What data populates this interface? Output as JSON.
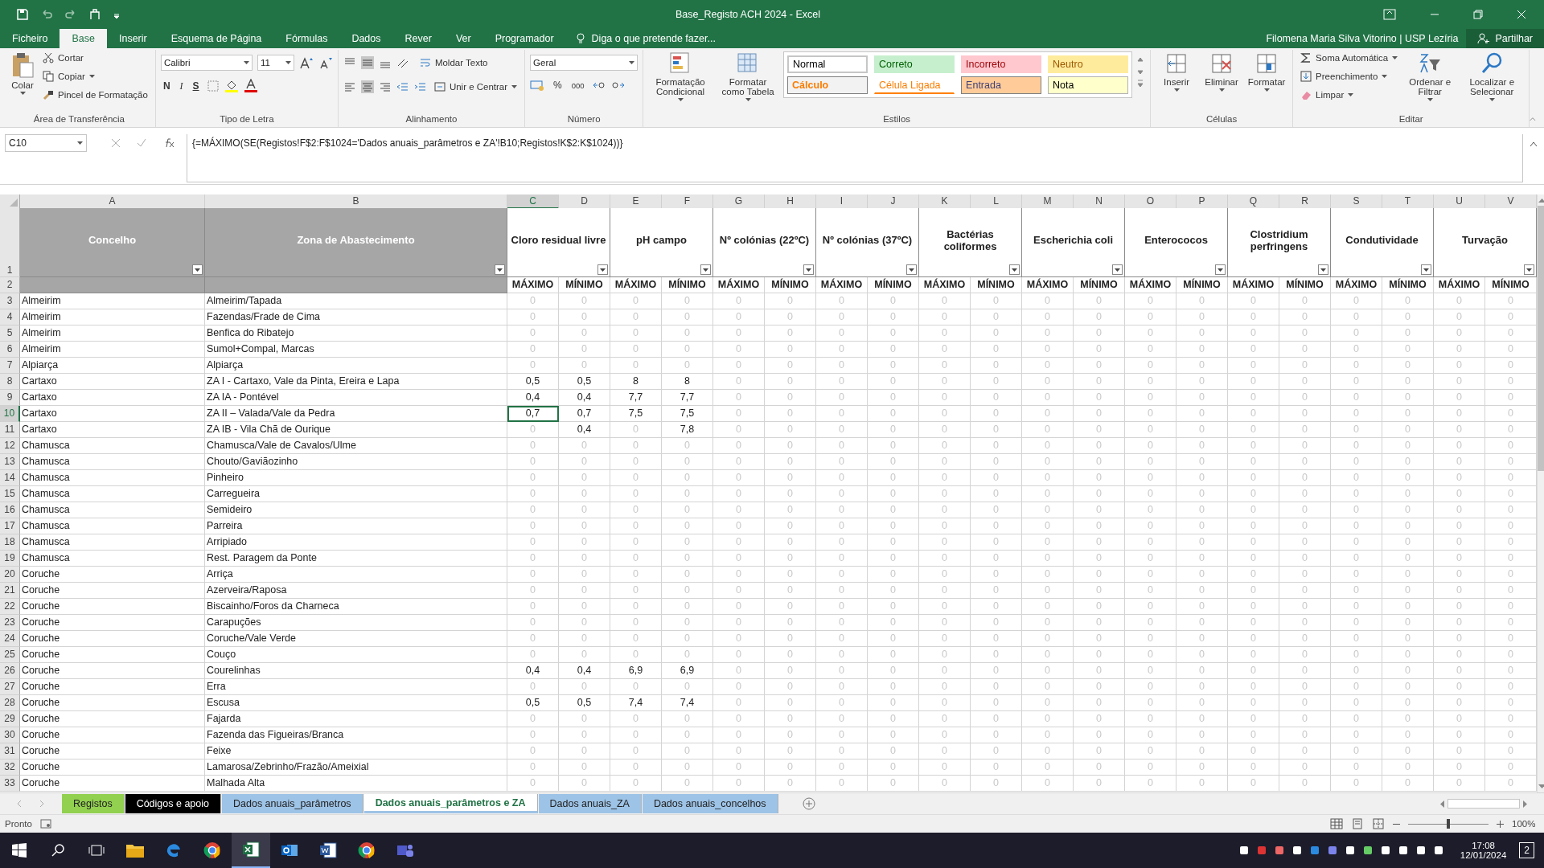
{
  "window": {
    "title": "Base_Registo ACH 2024 - Excel",
    "user": "Filomena Maria Silva Vitorino | USP Lezíria",
    "share": "Partilhar"
  },
  "menu_tabs": [
    {
      "label": "Ficheiro",
      "selected": false
    },
    {
      "label": "Base",
      "selected": true
    },
    {
      "label": "Inserir",
      "selected": false
    },
    {
      "label": "Esquema de Página",
      "selected": false
    },
    {
      "label": "Fórmulas",
      "selected": false
    },
    {
      "label": "Dados",
      "selected": false
    },
    {
      "label": "Rever",
      "selected": false
    },
    {
      "label": "Ver",
      "selected": false
    },
    {
      "label": "Programador",
      "selected": false
    }
  ],
  "tell_me": {
    "placeholder": "Diga o que pretende fazer..."
  },
  "ribbon": {
    "clipboard": {
      "label": "Área de Transferência",
      "paste": "Colar",
      "cut": "Cortar",
      "copy": "Copiar",
      "painter": "Pincel de Formatação"
    },
    "font": {
      "label": "Tipo de Letra",
      "name": "Calibri",
      "size": "11",
      "bold": "N",
      "italic": "I",
      "underline": "S"
    },
    "alignment": {
      "label": "Alinhamento",
      "wrap": "Moldar Texto",
      "merge": "Unir e Centrar"
    },
    "number": {
      "label": "Número",
      "format": "Geral",
      "percent": "%",
      "thousands": "000"
    },
    "styles": {
      "label": "Estilos",
      "conditional": "Formatação Condicional",
      "table": "Formatar como Tabela",
      "gallery": [
        {
          "label": "Normal",
          "kind": "normal"
        },
        {
          "label": "Correto",
          "kind": "good"
        },
        {
          "label": "Incorreto",
          "kind": "bad"
        },
        {
          "label": "Neutro",
          "kind": "neutral"
        },
        {
          "label": "Cálculo",
          "kind": "calc"
        },
        {
          "label": "Célula Ligada",
          "kind": "linked"
        },
        {
          "label": "Entrada",
          "kind": "input"
        },
        {
          "label": "Nota",
          "kind": "note"
        }
      ]
    },
    "cells": {
      "label": "Células",
      "buttons": [
        "Inserir",
        "Eliminar",
        "Formatar"
      ]
    },
    "editing": {
      "label": "Editar",
      "autosum": "Soma Automática",
      "fill": "Preenchimento",
      "clear": "Limpar",
      "sort": "Ordenar e Filtrar",
      "find": "Localizar e Selecionar"
    }
  },
  "formula_bar": {
    "name_box": "C10",
    "formula": "{=MÁXIMO(SE(Registos!F$2:F$1024='Dados anuais_parâmetros e ZA'!B10;Registos!K$2:K$1024))}"
  },
  "sheet": {
    "columns": [
      {
        "letter": "A",
        "selected": false
      },
      {
        "letter": "B",
        "selected": false
      },
      {
        "letter": "C",
        "selected": true
      },
      {
        "letter": "D",
        "selected": false
      },
      {
        "letter": "E",
        "selected": false
      },
      {
        "letter": "F",
        "selected": false
      },
      {
        "letter": "G",
        "selected": false
      },
      {
        "letter": "H",
        "selected": false
      },
      {
        "letter": "I",
        "selected": false
      },
      {
        "letter": "J",
        "selected": false
      },
      {
        "letter": "K",
        "selected": false
      },
      {
        "letter": "L",
        "selected": false
      },
      {
        "letter": "M",
        "selected": false
      },
      {
        "letter": "N",
        "selected": false
      },
      {
        "letter": "O",
        "selected": false
      },
      {
        "letter": "P",
        "selected": false
      },
      {
        "letter": "Q",
        "selected": false
      },
      {
        "letter": "R",
        "selected": false
      },
      {
        "letter": "S",
        "selected": false
      },
      {
        "letter": "T",
        "selected": false
      },
      {
        "letter": "U",
        "selected": false
      },
      {
        "letter": "V",
        "selected": false
      }
    ],
    "header_row": {
      "number": "1",
      "concelho": "Concelho",
      "zona": "Zona de Abastecimento",
      "parameters": [
        "Cloro residual livre",
        "pH campo",
        "Nº colónias (22ºC)",
        "Nº colónias (37ºC)",
        "Bactérias coliformes",
        "Escherichia coli",
        "Enterococos",
        "Clostridium perfringens",
        "Condutividade",
        "Turvação"
      ]
    },
    "subheader_row": {
      "number": "2",
      "labels": [
        "MÁXIMO",
        "MÍNIMO",
        "MÁXIMO",
        "MÍNIMO",
        "MÁXIMO",
        "MÍNIMO",
        "MÁXIMO",
        "MÍNIMO",
        "MÁXIMO",
        "MÍNIMO",
        "MÁXIMO",
        "MÍNIMO",
        "MÁXIMO",
        "MÍNIMO",
        "MÁXIMO",
        "MÍNIMO",
        "MÁXIMO",
        "MÍNIMO",
        "MÁXIMO",
        "MÍNIMO"
      ]
    },
    "rows": [
      {
        "number": "3",
        "selected": false,
        "concelho": "Almeirim",
        "zona": "Almeirim/Tapada",
        "values": [
          "0",
          "0",
          "0",
          "0",
          "0",
          "0",
          "0",
          "0",
          "0",
          "0",
          "0",
          "0",
          "0",
          "0",
          "0",
          "0",
          "0",
          "0",
          "0",
          "0"
        ]
      },
      {
        "number": "4",
        "selected": false,
        "concelho": "Almeirim",
        "zona": "Fazendas/Frade de Cima",
        "values": [
          "0",
          "0",
          "0",
          "0",
          "0",
          "0",
          "0",
          "0",
          "0",
          "0",
          "0",
          "0",
          "0",
          "0",
          "0",
          "0",
          "0",
          "0",
          "0",
          "0"
        ]
      },
      {
        "number": "5",
        "selected": false,
        "concelho": "Almeirim",
        "zona": "Benfica do Ribatejo",
        "values": [
          "0",
          "0",
          "0",
          "0",
          "0",
          "0",
          "0",
          "0",
          "0",
          "0",
          "0",
          "0",
          "0",
          "0",
          "0",
          "0",
          "0",
          "0",
          "0",
          "0"
        ]
      },
      {
        "number": "6",
        "selected": false,
        "concelho": "Almeirim",
        "zona": "Sumol+Compal, Marcas",
        "values": [
          "0",
          "0",
          "0",
          "0",
          "0",
          "0",
          "0",
          "0",
          "0",
          "0",
          "0",
          "0",
          "0",
          "0",
          "0",
          "0",
          "0",
          "0",
          "0",
          "0"
        ]
      },
      {
        "number": "7",
        "selected": false,
        "concelho": "Alpiarça",
        "zona": "Alpiarça",
        "values": [
          "0",
          "0",
          "0",
          "0",
          "0",
          "0",
          "0",
          "0",
          "0",
          "0",
          "0",
          "0",
          "0",
          "0",
          "0",
          "0",
          "0",
          "0",
          "0",
          "0"
        ]
      },
      {
        "number": "8",
        "selected": false,
        "concelho": "Cartaxo",
        "zona": "ZA I - Cartaxo, Vale da Pinta, Ereira e Lapa",
        "values": [
          "0,5",
          "0,5",
          "8",
          "8",
          "0",
          "0",
          "0",
          "0",
          "0",
          "0",
          "0",
          "0",
          "0",
          "0",
          "0",
          "0",
          "0",
          "0",
          "0",
          "0"
        ]
      },
      {
        "number": "9",
        "selected": false,
        "concelho": "Cartaxo",
        "zona": "ZA IA - Pontével",
        "values": [
          "0,4",
          "0,4",
          "7,7",
          "7,7",
          "0",
          "0",
          "0",
          "0",
          "0",
          "0",
          "0",
          "0",
          "0",
          "0",
          "0",
          "0",
          "0",
          "0",
          "0",
          "0"
        ]
      },
      {
        "number": "10",
        "selected": true,
        "concelho": "Cartaxo",
        "zona": "ZA II – Valada/Vale da Pedra",
        "values": [
          "0,7",
          "0,7",
          "7,5",
          "7,5",
          "0",
          "0",
          "0",
          "0",
          "0",
          "0",
          "0",
          "0",
          "0",
          "0",
          "0",
          "0",
          "0",
          "0",
          "0",
          "0"
        ]
      },
      {
        "number": "11",
        "selected": false,
        "concelho": "Cartaxo",
        "zona": "ZA IB - Vila Chã de Ourique",
        "values": [
          "0",
          "0,4",
          "0",
          "7,8",
          "0",
          "0",
          "0",
          "0",
          "0",
          "0",
          "0",
          "0",
          "0",
          "0",
          "0",
          "0",
          "0",
          "0",
          "0",
          "0"
        ]
      },
      {
        "number": "12",
        "selected": false,
        "concelho": "Chamusca",
        "zona": "Chamusca/Vale de Cavalos/Ulme",
        "values": [
          "0",
          "0",
          "0",
          "0",
          "0",
          "0",
          "0",
          "0",
          "0",
          "0",
          "0",
          "0",
          "0",
          "0",
          "0",
          "0",
          "0",
          "0",
          "0",
          "0"
        ]
      },
      {
        "number": "13",
        "selected": false,
        "concelho": "Chamusca",
        "zona": "Chouto/Gaviãozinho",
        "values": [
          "0",
          "0",
          "0",
          "0",
          "0",
          "0",
          "0",
          "0",
          "0",
          "0",
          "0",
          "0",
          "0",
          "0",
          "0",
          "0",
          "0",
          "0",
          "0",
          "0"
        ]
      },
      {
        "number": "14",
        "selected": false,
        "concelho": "Chamusca",
        "zona": "Pinheiro",
        "values": [
          "0",
          "0",
          "0",
          "0",
          "0",
          "0",
          "0",
          "0",
          "0",
          "0",
          "0",
          "0",
          "0",
          "0",
          "0",
          "0",
          "0",
          "0",
          "0",
          "0"
        ]
      },
      {
        "number": "15",
        "selected": false,
        "concelho": "Chamusca",
        "zona": "Carregueira",
        "values": [
          "0",
          "0",
          "0",
          "0",
          "0",
          "0",
          "0",
          "0",
          "0",
          "0",
          "0",
          "0",
          "0",
          "0",
          "0",
          "0",
          "0",
          "0",
          "0",
          "0"
        ]
      },
      {
        "number": "16",
        "selected": false,
        "concelho": "Chamusca",
        "zona": "Semideiro",
        "values": [
          "0",
          "0",
          "0",
          "0",
          "0",
          "0",
          "0",
          "0",
          "0",
          "0",
          "0",
          "0",
          "0",
          "0",
          "0",
          "0",
          "0",
          "0",
          "0",
          "0"
        ]
      },
      {
        "number": "17",
        "selected": false,
        "concelho": "Chamusca",
        "zona": "Parreira",
        "values": [
          "0",
          "0",
          "0",
          "0",
          "0",
          "0",
          "0",
          "0",
          "0",
          "0",
          "0",
          "0",
          "0",
          "0",
          "0",
          "0",
          "0",
          "0",
          "0",
          "0"
        ]
      },
      {
        "number": "18",
        "selected": false,
        "concelho": "Chamusca",
        "zona": "Arripiado",
        "values": [
          "0",
          "0",
          "0",
          "0",
          "0",
          "0",
          "0",
          "0",
          "0",
          "0",
          "0",
          "0",
          "0",
          "0",
          "0",
          "0",
          "0",
          "0",
          "0",
          "0"
        ]
      },
      {
        "number": "19",
        "selected": false,
        "concelho": "Chamusca",
        "zona": "Rest. Paragem da Ponte",
        "values": [
          "0",
          "0",
          "0",
          "0",
          "0",
          "0",
          "0",
          "0",
          "0",
          "0",
          "0",
          "0",
          "0",
          "0",
          "0",
          "0",
          "0",
          "0",
          "0",
          "0"
        ]
      },
      {
        "number": "20",
        "selected": false,
        "concelho": "Coruche",
        "zona": "Arriça",
        "values": [
          "0",
          "0",
          "0",
          "0",
          "0",
          "0",
          "0",
          "0",
          "0",
          "0",
          "0",
          "0",
          "0",
          "0",
          "0",
          "0",
          "0",
          "0",
          "0",
          "0"
        ]
      },
      {
        "number": "21",
        "selected": false,
        "concelho": "Coruche",
        "zona": "Azerveira/Raposa",
        "values": [
          "0",
          "0",
          "0",
          "0",
          "0",
          "0",
          "0",
          "0",
          "0",
          "0",
          "0",
          "0",
          "0",
          "0",
          "0",
          "0",
          "0",
          "0",
          "0",
          "0"
        ]
      },
      {
        "number": "22",
        "selected": false,
        "concelho": "Coruche",
        "zona": "Biscainho/Foros da Charneca",
        "values": [
          "0",
          "0",
          "0",
          "0",
          "0",
          "0",
          "0",
          "0",
          "0",
          "0",
          "0",
          "0",
          "0",
          "0",
          "0",
          "0",
          "0",
          "0",
          "0",
          "0"
        ]
      },
      {
        "number": "23",
        "selected": false,
        "concelho": "Coruche",
        "zona": "Carapuções",
        "values": [
          "0",
          "0",
          "0",
          "0",
          "0",
          "0",
          "0",
          "0",
          "0",
          "0",
          "0",
          "0",
          "0",
          "0",
          "0",
          "0",
          "0",
          "0",
          "0",
          "0"
        ]
      },
      {
        "number": "24",
        "selected": false,
        "concelho": "Coruche",
        "zona": "Coruche/Vale Verde",
        "values": [
          "0",
          "0",
          "0",
          "0",
          "0",
          "0",
          "0",
          "0",
          "0",
          "0",
          "0",
          "0",
          "0",
          "0",
          "0",
          "0",
          "0",
          "0",
          "0",
          "0"
        ]
      },
      {
        "number": "25",
        "selected": false,
        "concelho": "Coruche",
        "zona": "Couço",
        "values": [
          "0",
          "0",
          "0",
          "0",
          "0",
          "0",
          "0",
          "0",
          "0",
          "0",
          "0",
          "0",
          "0",
          "0",
          "0",
          "0",
          "0",
          "0",
          "0",
          "0"
        ]
      },
      {
        "number": "26",
        "selected": false,
        "concelho": "Coruche",
        "zona": "Courelinhas",
        "values": [
          "0,4",
          "0,4",
          "6,9",
          "6,9",
          "0",
          "0",
          "0",
          "0",
          "0",
          "0",
          "0",
          "0",
          "0",
          "0",
          "0",
          "0",
          "0",
          "0",
          "0",
          "0"
        ]
      },
      {
        "number": "27",
        "selected": false,
        "concelho": "Coruche",
        "zona": "Erra",
        "values": [
          "0",
          "0",
          "0",
          "0",
          "0",
          "0",
          "0",
          "0",
          "0",
          "0",
          "0",
          "0",
          "0",
          "0",
          "0",
          "0",
          "0",
          "0",
          "0",
          "0"
        ]
      },
      {
        "number": "28",
        "selected": false,
        "concelho": "Coruche",
        "zona": "Escusa",
        "values": [
          "0,5",
          "0,5",
          "7,4",
          "7,4",
          "0",
          "0",
          "0",
          "0",
          "0",
          "0",
          "0",
          "0",
          "0",
          "0",
          "0",
          "0",
          "0",
          "0",
          "0",
          "0"
        ]
      },
      {
        "number": "29",
        "selected": false,
        "concelho": "Coruche",
        "zona": "Fajarda",
        "values": [
          "0",
          "0",
          "0",
          "0",
          "0",
          "0",
          "0",
          "0",
          "0",
          "0",
          "0",
          "0",
          "0",
          "0",
          "0",
          "0",
          "0",
          "0",
          "0",
          "0"
        ]
      },
      {
        "number": "30",
        "selected": false,
        "concelho": "Coruche",
        "zona": "Fazenda das Figueiras/Branca",
        "values": [
          "0",
          "0",
          "0",
          "0",
          "0",
          "0",
          "0",
          "0",
          "0",
          "0",
          "0",
          "0",
          "0",
          "0",
          "0",
          "0",
          "0",
          "0",
          "0",
          "0"
        ]
      },
      {
        "number": "31",
        "selected": false,
        "concelho": "Coruche",
        "zona": "Feixe",
        "values": [
          "0",
          "0",
          "0",
          "0",
          "0",
          "0",
          "0",
          "0",
          "0",
          "0",
          "0",
          "0",
          "0",
          "0",
          "0",
          "0",
          "0",
          "0",
          "0",
          "0"
        ]
      },
      {
        "number": "32",
        "selected": false,
        "concelho": "Coruche",
        "zona": "Lamarosa/Zebrinho/Frazão/Ameixial",
        "values": [
          "0",
          "0",
          "0",
          "0",
          "0",
          "0",
          "0",
          "0",
          "0",
          "0",
          "0",
          "0",
          "0",
          "0",
          "0",
          "0",
          "0",
          "0",
          "0",
          "0"
        ]
      },
      {
        "number": "33",
        "selected": false,
        "concelho": "Coruche",
        "zona": "Malhada Alta",
        "values": [
          "0",
          "0",
          "0",
          "0",
          "0",
          "0",
          "0",
          "0",
          "0",
          "0",
          "0",
          "0",
          "0",
          "0",
          "0",
          "0",
          "0",
          "0",
          "0",
          "0"
        ]
      }
    ]
  },
  "sheet_tabs": [
    {
      "label": "Registos",
      "color": "#92d050",
      "selected": false
    },
    {
      "label": "Códigos e apoio",
      "color": "#000000",
      "selected": false
    },
    {
      "label": "Dados anuais_parâmetros",
      "color": "#9dc3e6",
      "selected": false
    },
    {
      "label": "Dados anuais_parâmetros e ZA",
      "color": "#9dc3e6",
      "selected": true
    },
    {
      "label": "Dados anuais_ZA",
      "color": "#9dc3e6",
      "selected": false
    },
    {
      "label": "Dados anuais_concelhos",
      "color": "#9dc3e6",
      "selected": false
    }
  ],
  "status_bar": {
    "status": "Pronto",
    "zoom": {
      "level": 0.5,
      "reading": "100%"
    }
  },
  "taskbar": {
    "time": "17:08",
    "date": "12/01/2024",
    "notifications": "2"
  }
}
